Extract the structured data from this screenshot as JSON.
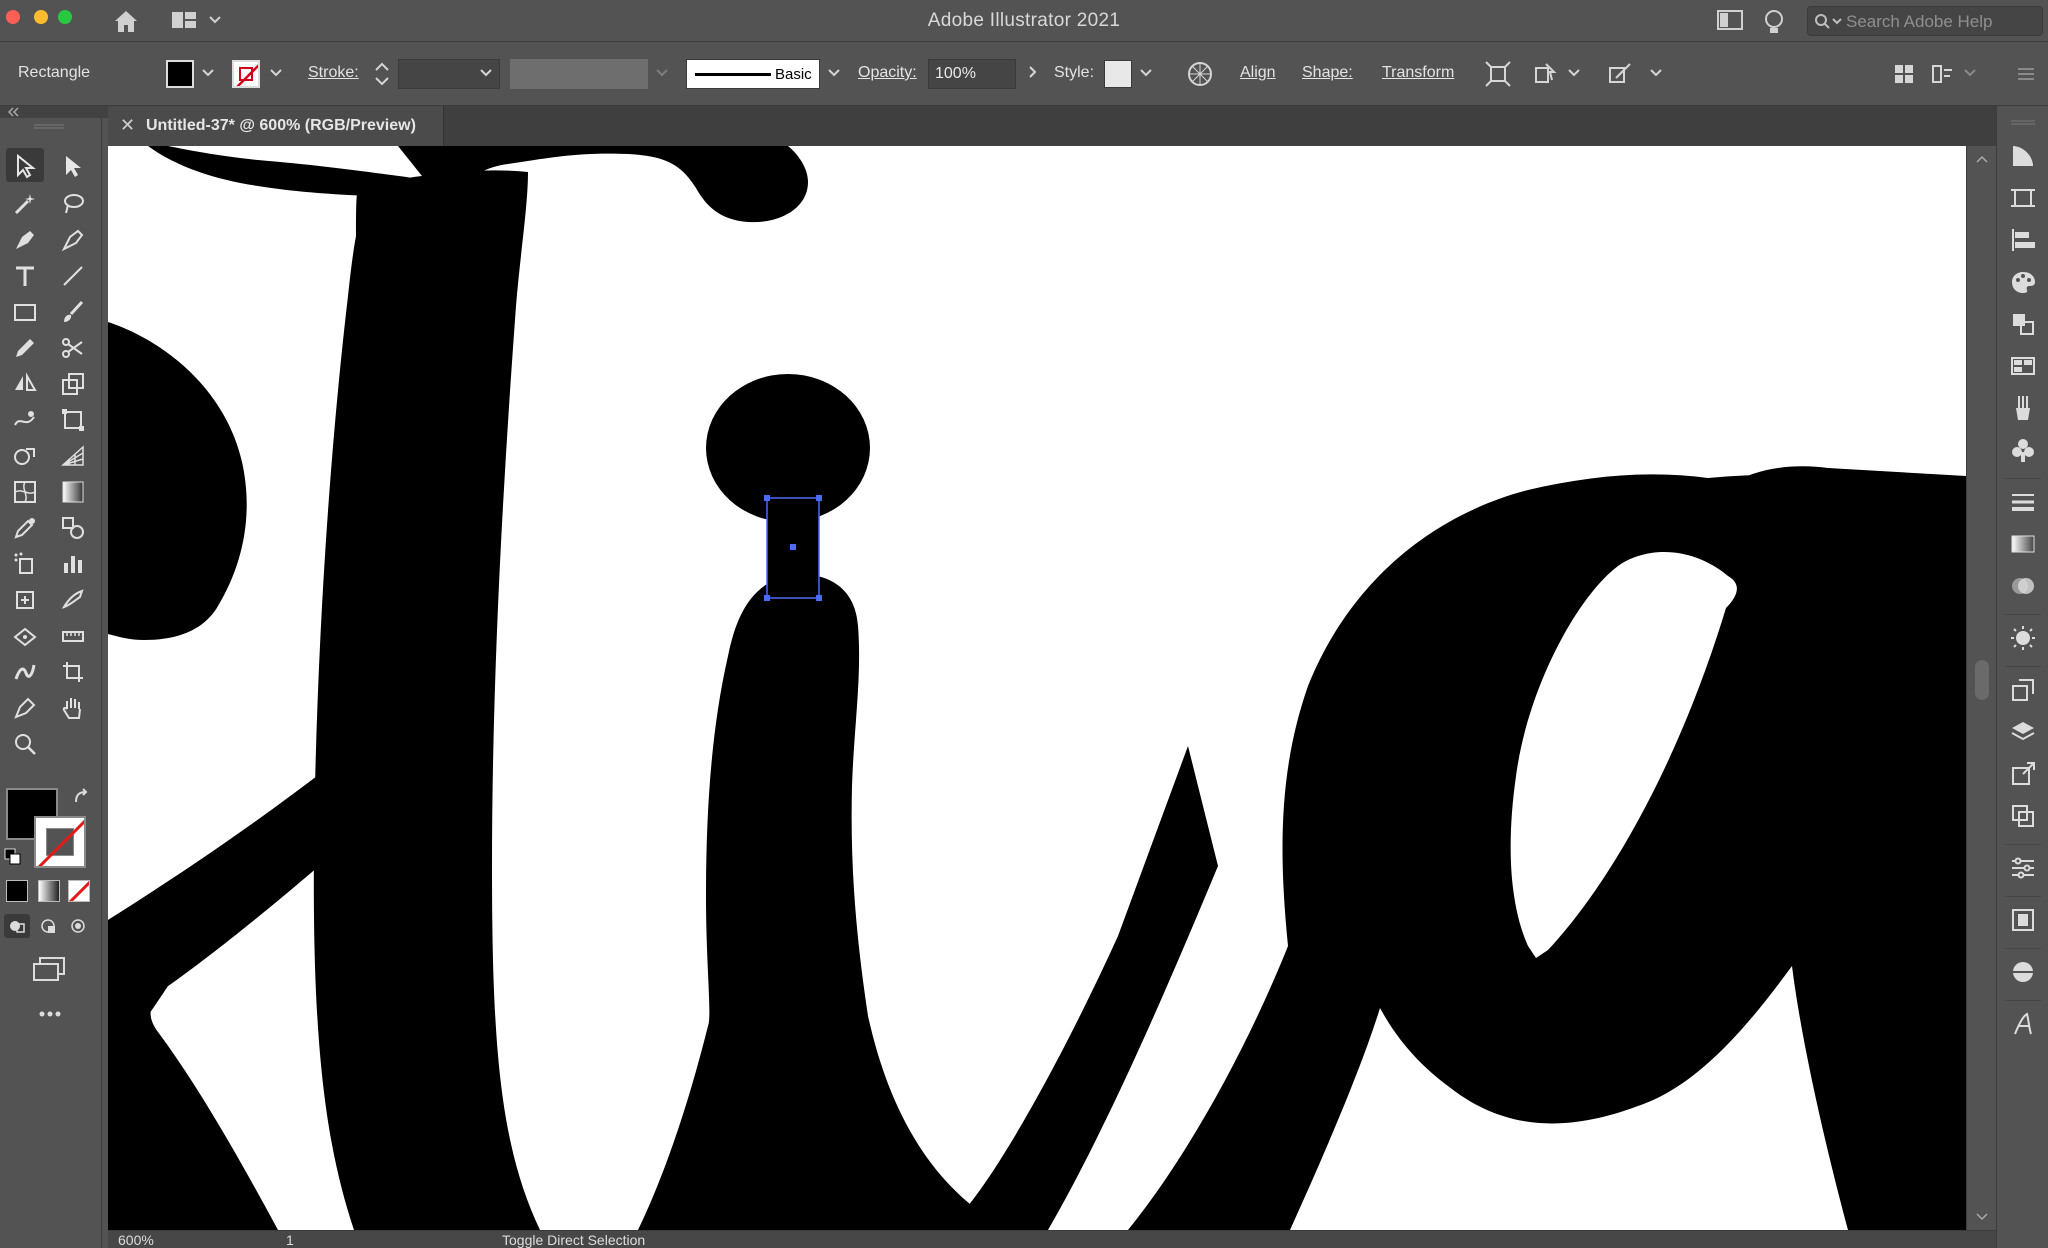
{
  "app": {
    "title": "Adobe Illustrator 2021",
    "search_placeholder": "Search Adobe Help"
  },
  "control_bar": {
    "selection_type": "Rectangle",
    "stroke_label": "Stroke:",
    "stroke_weight": "",
    "brush_label": "Basic",
    "opacity_label": "Opacity:",
    "opacity_value": "100%",
    "style_label": "Style:",
    "align_label": "Align",
    "shape_label": "Shape:",
    "transform_label": "Transform"
  },
  "document_tab": {
    "close_glyph": "✕",
    "title": "Untitled-37* @ 600% (RGB/Preview)"
  },
  "status_bar": {
    "zoom": "600%",
    "page": "1",
    "current_tool": "Toggle Direct Selection"
  },
  "colors": {
    "fill": "#000000",
    "stroke": "none",
    "selection": "#4a6cf7",
    "ui_background": "#535353"
  },
  "toolbar_tools": [
    "selection-tool",
    "direct-selection-tool",
    "magic-wand-tool",
    "lasso-tool",
    "pen-tool",
    "curvature-tool",
    "type-tool",
    "line-segment-tool",
    "rectangle-tool",
    "paintbrush-tool",
    "pencil-tool",
    "scissors-tool",
    "reflect-tool",
    "scale-tool",
    "warp-tool",
    "free-transform-tool",
    "shape-builder-tool",
    "perspective-grid-tool",
    "mesh-tool",
    "gradient-tool",
    "eyedropper-tool",
    "blend-tool",
    "symbol-sprayer-tool",
    "column-graph-tool",
    "artboard-tool",
    "slice-tool",
    "puppet-warp-tool",
    "measure-tool",
    "width-tool",
    "crop-image-tool",
    "pen-variant-tool",
    "hand-tool",
    "zoom-tool"
  ]
}
